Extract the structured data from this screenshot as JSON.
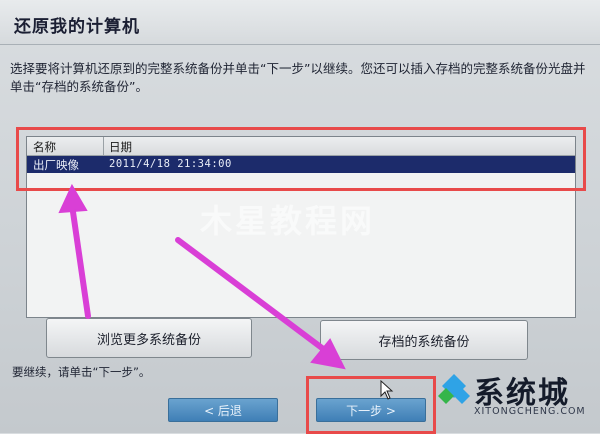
{
  "window": {
    "title": "还原我的计算机",
    "instruction": "选择要将计算机还原到的完整系统备份并单击“下一步”以继续。您还可以插入存档的完整系统备份光盘并单击“存档的系统备份”。"
  },
  "backup_list": {
    "columns": [
      "名称",
      "日期"
    ],
    "rows": [
      {
        "name": "出厂映像",
        "date": "2011/4/18 21:34:00",
        "selected": true
      }
    ]
  },
  "buttons": {
    "browse_label": "浏览更多系统备份",
    "archive_label": "存档的系统备份",
    "back_label": "< 后退",
    "next_label": "下一步 >"
  },
  "continue_hint": "要继续，请单击“下一步”。",
  "watermark": "木星教程网",
  "logo": {
    "name": "系统城",
    "site": "XITONGCHENG.COM",
    "colors": [
      "#2fa3e6",
      "#35b54a"
    ]
  },
  "annotations": {
    "highlight_color": "#e84a4a",
    "arrow_color": "#d93fd6"
  }
}
